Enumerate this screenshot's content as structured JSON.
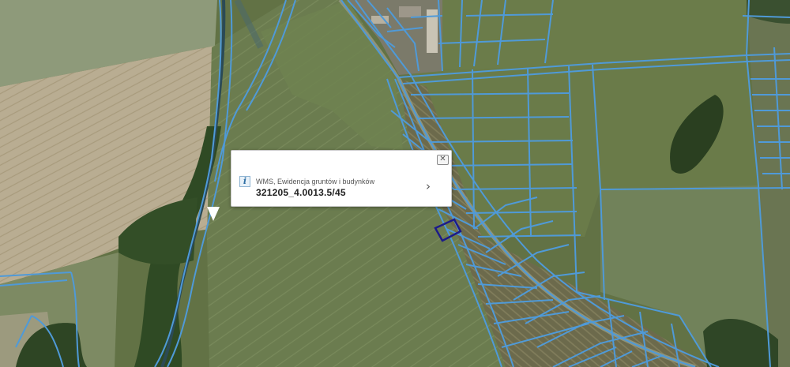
{
  "popup": {
    "layer_name": "WMS, Ewidencja gruntów i budynków",
    "parcel_id": "321205_4.0013.5/45",
    "close_glyph": "✕",
    "chevron_glyph": "›",
    "info_glyph": "i"
  },
  "colors": {
    "parcel_boundary": "#4f9ad8",
    "selected_parcel": "#1c1a8a",
    "field_green": "#66774a",
    "field_tan": "#b7a98c",
    "forest": "#2f4a22"
  }
}
